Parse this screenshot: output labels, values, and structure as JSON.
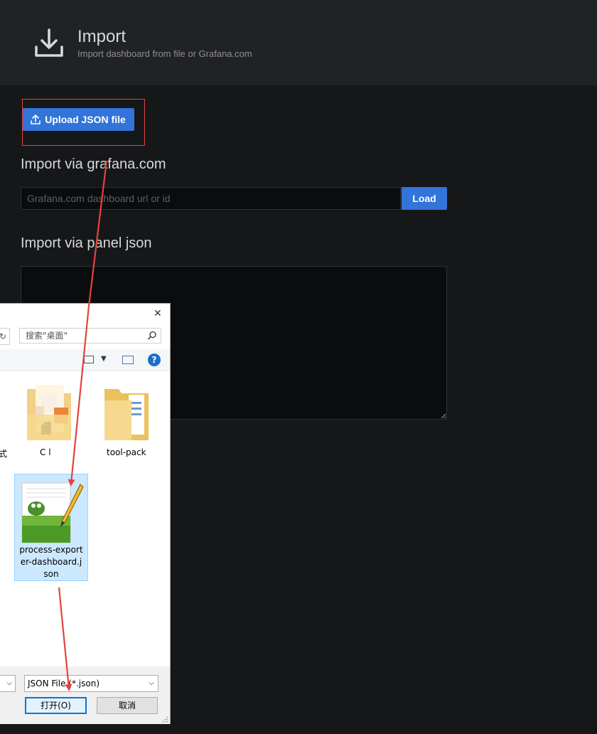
{
  "header": {
    "title": "Import",
    "subtitle": "Import dashboard from file or Grafana.com",
    "icon": "download-icon"
  },
  "upload": {
    "label": "Upload JSON file",
    "icon": "upload-icon"
  },
  "grafana_com": {
    "heading": "Import via grafana.com",
    "placeholder": "Grafana.com dashboard url or id",
    "value": "",
    "load_label": "Load"
  },
  "panel_json": {
    "heading": "Import via panel json",
    "value": ""
  },
  "file_dialog": {
    "search_placeholder": "搜索\"桌面\"",
    "items": [
      {
        "label": "式",
        "icon": "file-icon"
      },
      {
        "label": "C   l",
        "icon": "image-folder-icon"
      },
      {
        "label": "tool-pack",
        "icon": "folder-icon"
      }
    ],
    "selected_file": {
      "label_lines": [
        "process-export",
        "er-dashboard.j",
        "son"
      ],
      "icon": "notepad-plus-plus-icon"
    },
    "file_type": "JSON File (*.json)",
    "open_label": "打开(O)",
    "cancel_label": "取消"
  },
  "colors": {
    "primary_button": "#3274d9",
    "annotation": "#e5433f",
    "background": "#161719",
    "header_background": "#202226"
  }
}
